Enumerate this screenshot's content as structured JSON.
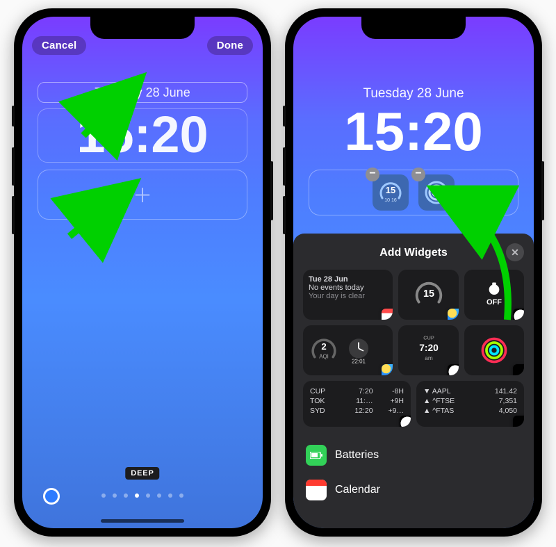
{
  "left": {
    "cancel": "Cancel",
    "done": "Done",
    "date": "Tuesday 28 June",
    "time": "15:20",
    "style": "DEEP"
  },
  "right": {
    "date": "Tuesday 28 June",
    "time": "15:20",
    "chip1_text": "15",
    "chip1_sub": "10 16",
    "sheet_title": "Add Widgets",
    "cal_widget": {
      "line1": "Tue 28 Jun",
      "line2": "No events today",
      "line3": "Your day is clear"
    },
    "weather_center": "15",
    "alarm_center": "OFF",
    "aqi_value": "2",
    "aqi_label": "AQI",
    "clock_city_time": "22:01",
    "clock_label": "CUP",
    "clock_am": "am",
    "world_clock": [
      {
        "city": "CUP",
        "time": "7:20",
        "delta": "-8H"
      },
      {
        "city": "TOK",
        "time": "11:…",
        "delta": "+9H"
      },
      {
        "city": "SYD",
        "time": "12:20",
        "delta": "+9…"
      }
    ],
    "stocks": [
      {
        "sym": "▼ AAPL",
        "val": "141.42"
      },
      {
        "sym": "▲ ^FTSE",
        "val": "7,351"
      },
      {
        "sym": "▲ ^FTAS",
        "val": "4,050"
      }
    ],
    "apps": {
      "batteries": "Batteries",
      "calendar": "Calendar"
    }
  }
}
